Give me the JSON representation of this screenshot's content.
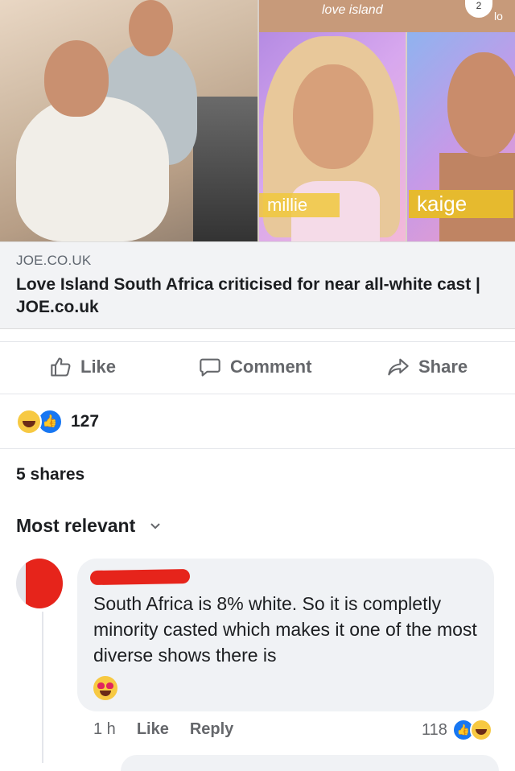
{
  "preview": {
    "logo_text": "love island",
    "logo_text_right": "lo",
    "number_badge": "2",
    "tags": [
      "millie",
      "kaige"
    ]
  },
  "link": {
    "domain": "JOE.CO.UK",
    "title": "Love Island South Africa criticised for near all-white cast | JOE.co.uk"
  },
  "actions": {
    "like": "Like",
    "comment": "Comment",
    "share": "Share"
  },
  "reactions": {
    "count": "127",
    "icons": [
      "haha-emoji",
      "like-emoji"
    ]
  },
  "shares": "5 shares",
  "sort": {
    "label": "Most relevant"
  },
  "comment": {
    "text": "South Africa is 8% white. So it is completly minority casted which makes it one of the most diverse shows there is",
    "emoji": "heart-eyes-emoji",
    "time": "1 h",
    "like": "Like",
    "reply": "Reply",
    "reaction_count": "118"
  },
  "colors": {
    "accent": "#1877f2",
    "redaction": "#e6241b",
    "bubble": "#f0f2f5",
    "muted_text": "#65676b"
  }
}
